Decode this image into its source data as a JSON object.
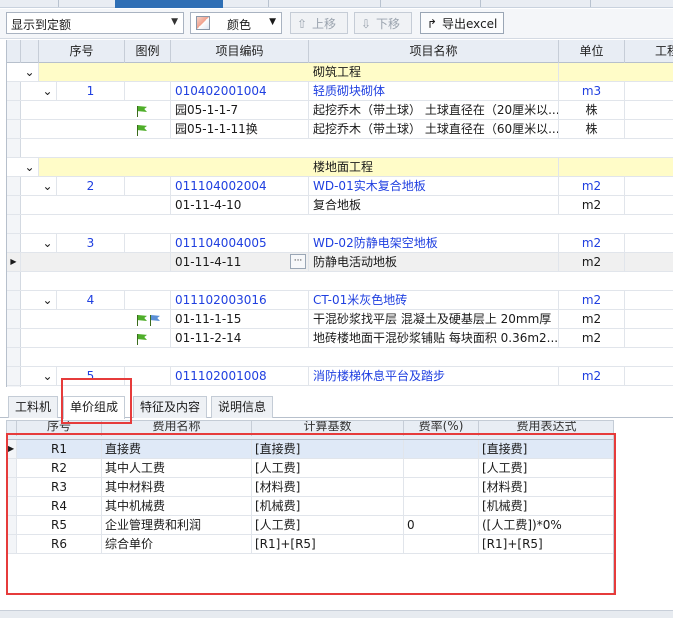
{
  "toolbar": {
    "display_select": "显示到定额",
    "color_label": "颜色",
    "move_up": "上移",
    "move_down": "下移",
    "export_excel": "导出excel"
  },
  "grid": {
    "columns": [
      "序号",
      "图例",
      "项目编码",
      "项目名称",
      "单位",
      "工程"
    ],
    "rows": [
      {
        "kind": "section",
        "name": "砌筑工程"
      },
      {
        "kind": "item",
        "seq": "1",
        "code": "010402001004",
        "name": "轻质砌块砌体",
        "unit": "m3"
      },
      {
        "kind": "quota",
        "flags": [
          "green"
        ],
        "code": "园05-1-1-7",
        "name": "起挖乔木（带土球） 土球直径在（20厘米以...",
        "unit": "株"
      },
      {
        "kind": "quota",
        "flags": [
          "green"
        ],
        "code": "园05-1-1-11换",
        "name": "起挖乔木（带土球） 土球直径在（60厘米以...",
        "unit": "株"
      },
      {
        "kind": "blank"
      },
      {
        "kind": "section",
        "name": "楼地面工程"
      },
      {
        "kind": "item",
        "seq": "2",
        "code": "011104002004",
        "name": "WD-01实木复合地板",
        "unit": "m2"
      },
      {
        "kind": "quota",
        "flags": [],
        "code": "01-11-4-10",
        "name": "复合地板",
        "unit": "m2"
      },
      {
        "kind": "blank"
      },
      {
        "kind": "item",
        "seq": "3",
        "code": "011104004005",
        "name": "WD-02防静电架空地板",
        "unit": "m2"
      },
      {
        "kind": "quota",
        "flags": [],
        "code": "01-11-4-11",
        "name": "防静电活动地板",
        "unit": "m2",
        "selected": true
      },
      {
        "kind": "blank"
      },
      {
        "kind": "item",
        "seq": "4",
        "code": "011102003016",
        "name": "CT-01米灰色地砖",
        "unit": "m2"
      },
      {
        "kind": "quota",
        "flags": [
          "green",
          "blue"
        ],
        "code": "01-11-1-15",
        "name": "干混砂浆找平层 混凝土及硬基层上 20mm厚",
        "unit": "m2"
      },
      {
        "kind": "quota",
        "flags": [
          "green"
        ],
        "code": "01-11-2-14",
        "name": "地砖楼地面干混砂浆铺贴 每块面积 0.36m2...",
        "unit": "m2"
      },
      {
        "kind": "blank"
      },
      {
        "kind": "item",
        "seq": "5",
        "code": "011102001008",
        "name": "消防楼梯休息平台及踏步",
        "unit": "m2"
      }
    ]
  },
  "tabs": [
    "工料机",
    "单价组成",
    "特征及内容",
    "说明信息"
  ],
  "active_tab": "单价组成",
  "price_table": {
    "columns": [
      "序号",
      "费用名称",
      "计算基数",
      "费率(%)",
      "费用表达式"
    ],
    "rows": [
      {
        "id": "R1",
        "name": "直接费",
        "base": "[直接费]",
        "rate": "",
        "expr": "[直接费]"
      },
      {
        "id": "R2",
        "name": "其中人工费",
        "base": "[人工费]",
        "rate": "",
        "expr": "[人工费]"
      },
      {
        "id": "R3",
        "name": "其中材料费",
        "base": "[材料费]",
        "rate": "",
        "expr": "[材料费]"
      },
      {
        "id": "R4",
        "name": "其中机械费",
        "base": "[机械费]",
        "rate": "",
        "expr": "[机械费]"
      },
      {
        "id": "R5",
        "name": "企业管理费和利润",
        "base": "[人工费]",
        "rate": "0",
        "expr": "([人工费])*0%"
      },
      {
        "id": "R6",
        "name": "综合单价",
        "base": "[R1]+[R5]",
        "rate": "",
        "expr": "[R1]+[R5]"
      }
    ]
  },
  "colors": {
    "accent": "#2f6fb5",
    "link_blue": "#1f3fe0",
    "section_yellow": "#fffcc8",
    "highlight_red": "#e63b3b"
  }
}
